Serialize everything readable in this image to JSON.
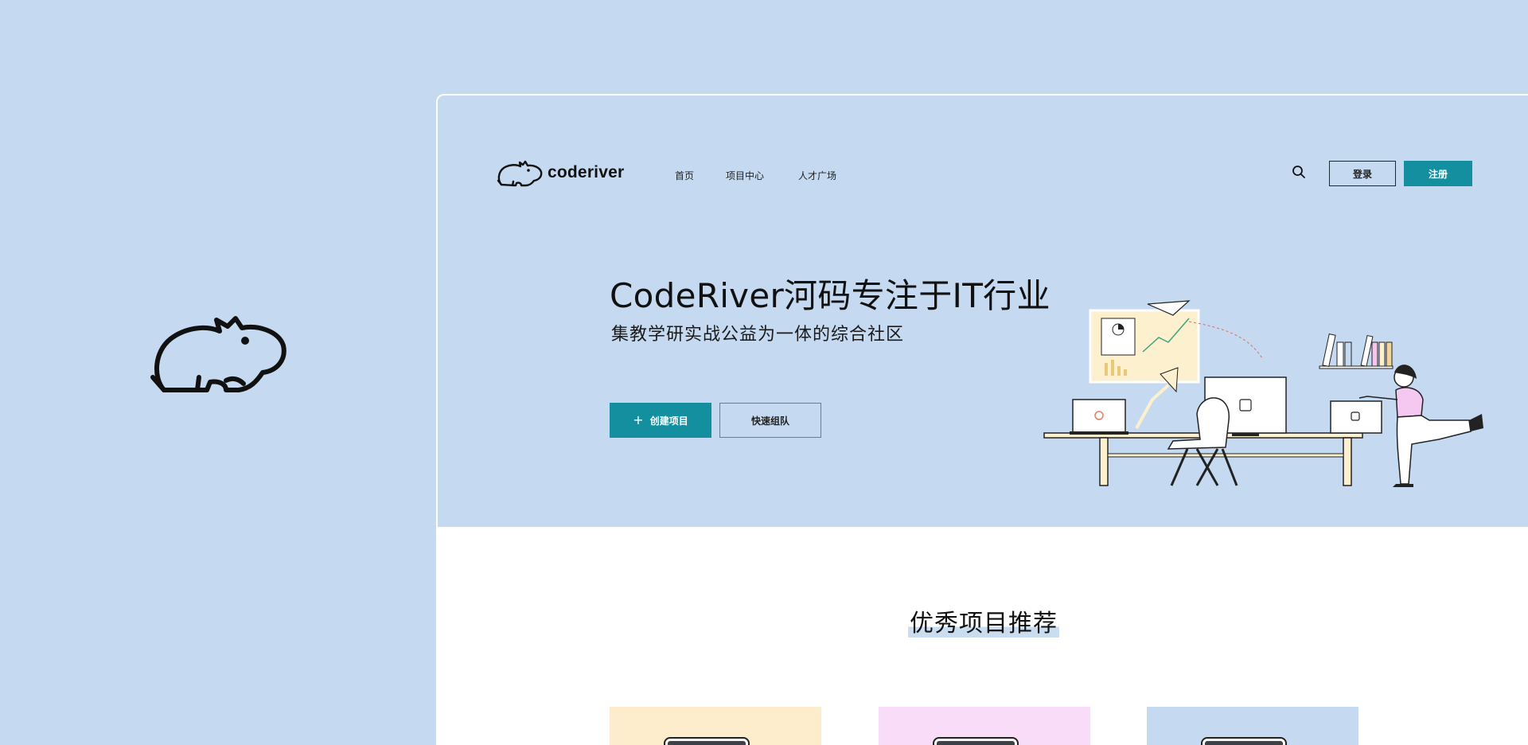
{
  "brand": {
    "name": "coderiver"
  },
  "nav": {
    "links": [
      "首页",
      "项目中心",
      "人才广场"
    ],
    "login_label": "登录",
    "register_label": "注册"
  },
  "hero": {
    "headline": "CodeRiver河码专注于IT行业",
    "subline": "集教学研实战公益为一体的综合社区",
    "create_label": "创建项目",
    "team_label": "快速组队"
  },
  "recommend": {
    "title": "优秀项目推荐",
    "card_colors": [
      "#fdedcc",
      "#f9dcf7",
      "#c5daf0"
    ]
  },
  "colors": {
    "background": "#c5daf0",
    "accent": "#148fa0",
    "content_bg": "#ffffff"
  },
  "icons": [
    "hippo-logo-icon",
    "search-icon",
    "plus-icon"
  ]
}
